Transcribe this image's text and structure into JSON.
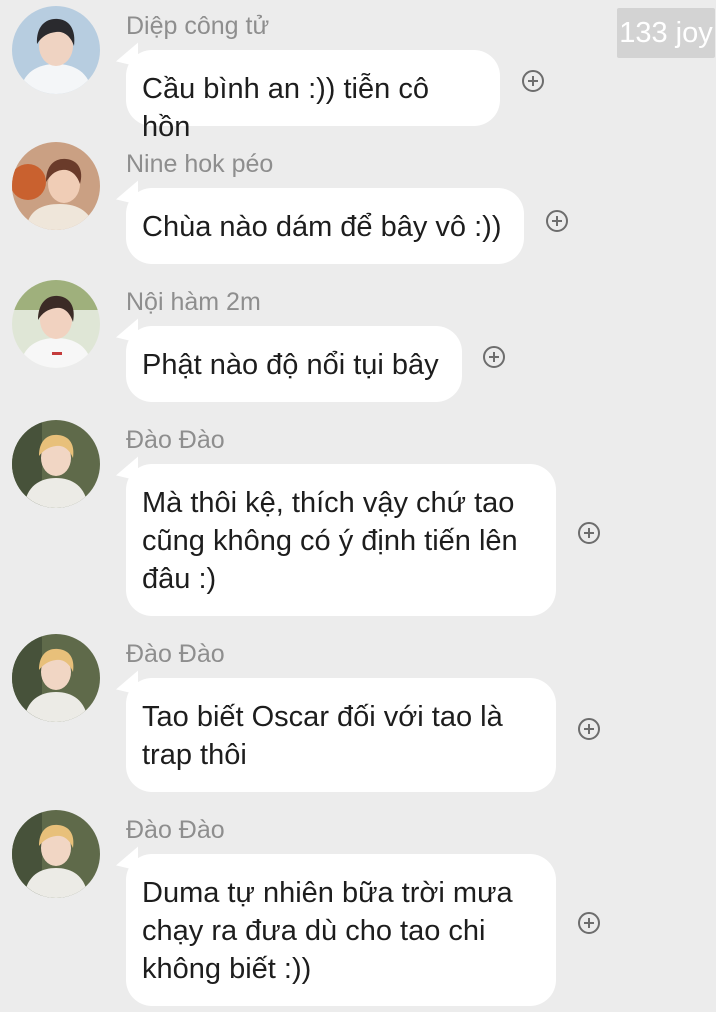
{
  "badge": {
    "text": "133 joy"
  },
  "messages": [
    {
      "sender": "Diệp công tử",
      "text": "Cầu bình an :)) tiễn cô hồn",
      "avatar": "avatar-white-hoodie"
    },
    {
      "sender": "Nine hok péo",
      "text": "Chùa nào dám để bây vô :))",
      "avatar": "avatar-basketball"
    },
    {
      "sender": "Nội hàm 2m",
      "text": "Phật nào độ nổi tụi bây",
      "avatar": "avatar-white-tee"
    },
    {
      "sender": "Đào Đào",
      "text": "Mà thôi kệ, thích vậy chứ tao\ncũng không có ý định tiến lên\nđâu :)",
      "avatar": "avatar-blonde"
    },
    {
      "sender": "Đào Đào",
      "text": "Tao biết Oscar đối với tao là\ntrap thôi",
      "avatar": "avatar-blonde"
    },
    {
      "sender": "Đào Đào",
      "text": "Duma tự nhiên bữa trời mưa\nchạy ra đưa dù cho tao chi\nkhông biết :))",
      "avatar": "avatar-blonde"
    }
  ],
  "colors": {
    "background": "#ececec",
    "bubble": "#ffffff",
    "sender": "#8e8e8e",
    "text": "#1d1d1d",
    "badge": "#d3d3d3"
  }
}
